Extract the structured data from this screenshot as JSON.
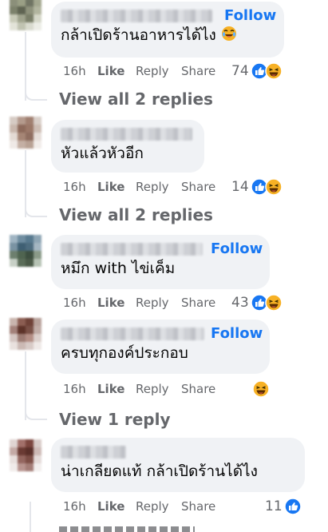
{
  "comments": [
    {
      "author": "",
      "follow_label": "Follow",
      "text": "กล้าเปิดร้านอาหารได้ไง",
      "time": "16h",
      "like": "Like",
      "reply": "Reply",
      "share": "Share",
      "reaction_count": "74",
      "reactions": [
        "like-icon",
        "haha-icon"
      ],
      "inline_emoji": "laughing-emoji-icon",
      "view_replies": "View all 2 replies"
    },
    {
      "author": "",
      "text": "หัวแล้วหัวอีก",
      "time": "16h",
      "like": "Like",
      "reply": "Reply",
      "share": "Share",
      "reaction_count": "14",
      "reactions": [
        "like-icon",
        "haha-icon"
      ],
      "view_replies": "View all 2 replies"
    },
    {
      "author": "",
      "follow_label": "Follow",
      "text": "หมึก with ไข่เค็ม",
      "time": "16h",
      "like": "Like",
      "reply": "Reply",
      "share": "Share",
      "reaction_count": "43",
      "reactions": [
        "like-icon",
        "haha-icon"
      ]
    },
    {
      "author": "",
      "follow_label": "Follow",
      "text": "ครบทุกองค์ประกอบ",
      "time": "16h",
      "like": "Like",
      "reply": "Reply",
      "share": "Share",
      "reaction_count": "",
      "reactions": [
        "haha-icon"
      ],
      "view_replies": "View 1 reply"
    },
    {
      "author": "",
      "text": "น่าเกลียดแท้ กล้าเปิดร้านได้ไง",
      "time": "16h",
      "like": "Like",
      "reply": "Reply",
      "share": "Share",
      "reaction_count": "11",
      "reactions": [
        "like-icon"
      ]
    }
  ],
  "colors": {
    "accent": "#1877f2",
    "muted": "#65676b",
    "bubble": "#f0f2f5",
    "haha": "#f7b125"
  }
}
